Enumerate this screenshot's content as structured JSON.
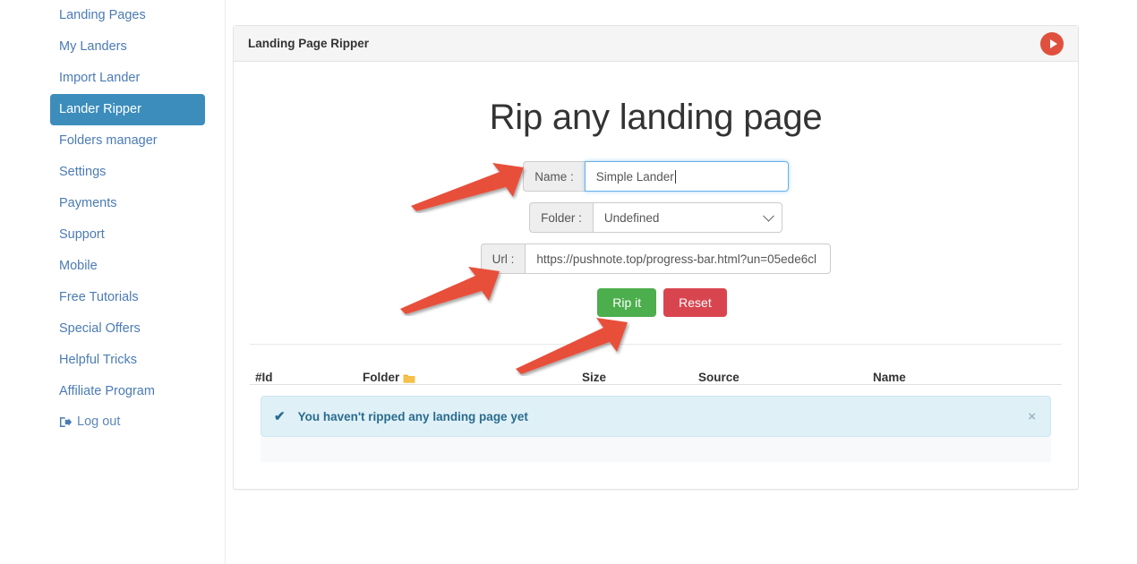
{
  "sidebar": {
    "items": [
      {
        "label": "Landing Pages",
        "active": false
      },
      {
        "label": "My Landers",
        "active": false
      },
      {
        "label": "Import Lander",
        "active": false
      },
      {
        "label": "Lander Ripper",
        "active": true
      },
      {
        "label": "Folders manager",
        "active": false
      },
      {
        "label": "Settings",
        "active": false
      },
      {
        "label": "Payments",
        "active": false
      },
      {
        "label": "Support",
        "active": false
      },
      {
        "label": "Mobile",
        "active": false
      },
      {
        "label": "Free Tutorials",
        "active": false
      },
      {
        "label": "Special Offers",
        "active": false
      },
      {
        "label": "Helpful Tricks",
        "active": false
      },
      {
        "label": "Affiliate Program",
        "active": false
      }
    ],
    "logout": {
      "label": "Log out",
      "icon": "sign-out-icon"
    },
    "active_color": "#3c8dbc",
    "link_color": "#4b7bb5"
  },
  "panel": {
    "title": "Landing Page Ripper",
    "video_icon": "play-circle-icon",
    "video_icon_color": "#e0503f"
  },
  "main": {
    "heading": "Rip any landing page",
    "form": {
      "name": {
        "label": "Name :",
        "value": "Simple Lander",
        "placeholder": "Name",
        "focused": true
      },
      "folder": {
        "label": "Folder :",
        "value": "Undefined",
        "options": [
          "Undefined"
        ],
        "chevron_icon": "chevron-down-icon"
      },
      "url": {
        "label": "Url :",
        "value": "https://pushnote.top/progress-bar.html?un=05ede6cl",
        "placeholder": "Url"
      }
    },
    "buttons": {
      "rip": {
        "label": "Rip it",
        "color": "#4cae4c"
      },
      "reset": {
        "label": "Reset",
        "color": "#d9454f"
      }
    }
  },
  "table": {
    "columns": [
      {
        "key": "id",
        "label": "#Id"
      },
      {
        "key": "folder",
        "label": "Folder",
        "icon": "folder-icon"
      },
      {
        "key": "size",
        "label": "Size"
      },
      {
        "key": "source",
        "label": "Source"
      },
      {
        "key": "name",
        "label": "Name"
      }
    ],
    "rows": [],
    "empty_alert": {
      "icon": "check-icon",
      "text": "You haven't ripped any landing page yet",
      "close_label": "×",
      "background": "#dff0f7",
      "text_color": "#2b6c8e"
    }
  },
  "annotations": {
    "arrows": [
      {
        "name": "arrow-to-name-field",
        "target": "name-field"
      },
      {
        "name": "arrow-to-url-field",
        "target": "url-field"
      },
      {
        "name": "arrow-to-rip-button",
        "target": "rip-it-button"
      }
    ],
    "color": "#e8503a"
  }
}
